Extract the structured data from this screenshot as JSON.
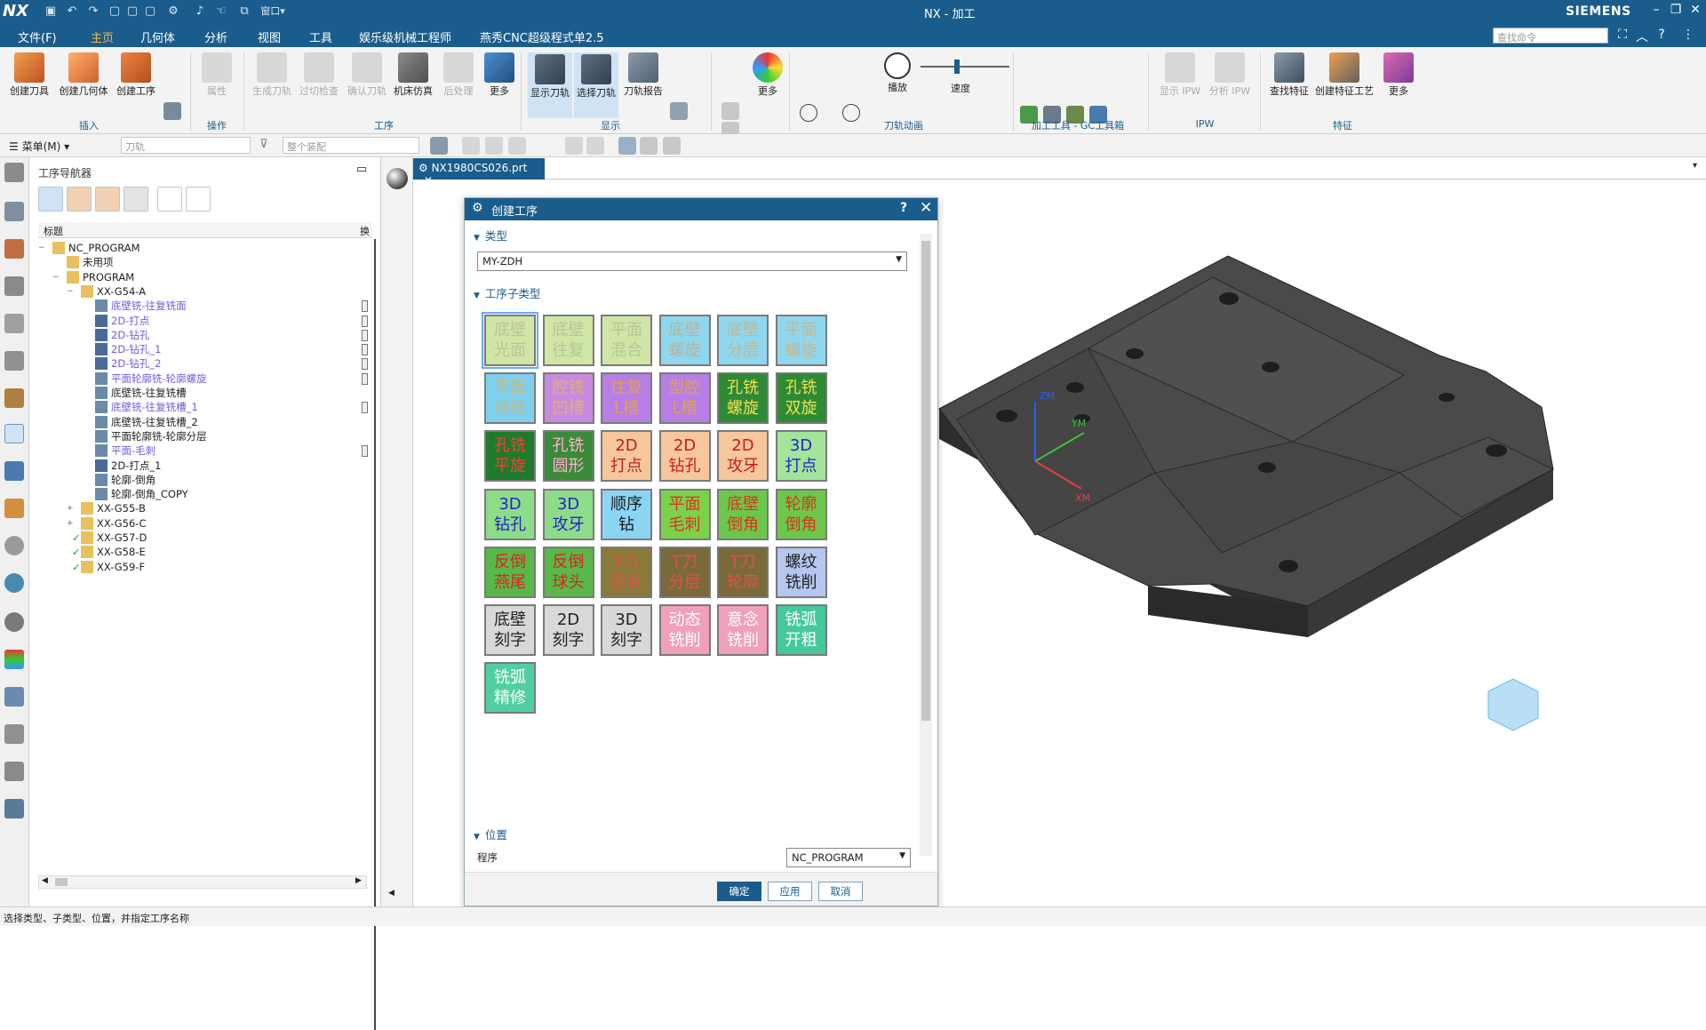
{
  "app": {
    "logo": "NX",
    "title": "NX - 加工",
    "brand": "SIEMENS"
  },
  "menu": {
    "items": [
      "文件(F)",
      "主页",
      "几何体",
      "分析",
      "视图",
      "工具",
      "娱乐级机械工程师",
      "燕秀CNC超级程式单2.5"
    ],
    "search_placeholder": "查找命令"
  },
  "ribbon": {
    "buttons": {
      "create_tool": "创建刀具",
      "create_geometry": "创建几何体",
      "create_operation": "创建工序",
      "properties": "属性",
      "generate_toolpath": "生成刀轨",
      "overcut_check": "过切检查",
      "verify_toolpath": "确认刀轨",
      "machine_sim": "机床仿真",
      "postprocess": "后处理",
      "more1": "更多",
      "show_toolpath": "显示刀轨",
      "select_toolpath": "选择刀轨",
      "toolpath_report": "刀轨报告",
      "more2": "更多",
      "play": "播放",
      "speed": "速度",
      "show_ipw": "显示 IPW",
      "analyze_ipw": "分析 IPW",
      "find_feature": "查找特征",
      "create_feature_process": "创建特征工艺",
      "more3": "更多"
    },
    "groups": {
      "insert": "插入",
      "operation": "操作",
      "process": "工序",
      "display": "显示",
      "toolpath_anim": "刀轨动画",
      "gc_toolkit": "加工工具 - GC工具箱",
      "ipw": "IPW",
      "feature": "特征"
    }
  },
  "selectionbar": {
    "menu": "菜单(M)",
    "filter": "刀轨",
    "scope": "整个装配"
  },
  "navigator": {
    "title": "工序导航器",
    "column_name": "标题",
    "column_change": "换",
    "tree": [
      {
        "label": "NC_PROGRAM",
        "level": 0,
        "color": "normal",
        "icon": "folder-icon",
        "mark": false
      },
      {
        "label": "未用项",
        "level": 1,
        "color": "normal",
        "icon": "folder-icon",
        "mark": false
      },
      {
        "label": "PROGRAM",
        "level": 1,
        "color": "normal",
        "icon": "folder-icon",
        "mark": false
      },
      {
        "label": "XX-G54-A",
        "level": 2,
        "color": "normal",
        "icon": "folder-icon",
        "mark": false
      },
      {
        "label": "底壁铣-往复铣面",
        "level": 3,
        "color": "purple",
        "icon": "op-icon",
        "mark": true
      },
      {
        "label": "2D-打点",
        "level": 3,
        "color": "purple",
        "icon": "drill-icon",
        "mark": true
      },
      {
        "label": "2D-钻孔",
        "level": 3,
        "color": "purple",
        "icon": "drill-icon",
        "mark": true
      },
      {
        "label": "2D-钻孔_1",
        "level": 3,
        "color": "purple",
        "icon": "drill-icon",
        "mark": true
      },
      {
        "label": "2D-钻孔_2",
        "level": 3,
        "color": "purple",
        "icon": "drill-icon",
        "mark": true
      },
      {
        "label": "平面轮廓铣-轮廓螺旋",
        "level": 3,
        "color": "purple",
        "icon": "op-icon",
        "mark": true
      },
      {
        "label": "底壁铣-往复铣槽",
        "level": 3,
        "color": "normal",
        "icon": "op-icon",
        "mark": false
      },
      {
        "label": "底壁铣-往复铣槽_1",
        "level": 3,
        "color": "purple",
        "icon": "op-icon",
        "mark": true
      },
      {
        "label": "底壁铣-往复铣槽_2",
        "level": 3,
        "color": "normal",
        "icon": "op-icon",
        "mark": false
      },
      {
        "label": "平面轮廓铣-轮廓分层",
        "level": 3,
        "color": "normal",
        "icon": "op-icon",
        "mark": false
      },
      {
        "label": "平面-毛刺",
        "level": 3,
        "color": "purple",
        "icon": "op-icon",
        "mark": true
      },
      {
        "label": "2D-打点_1",
        "level": 3,
        "color": "normal",
        "icon": "drill-icon",
        "mark": false
      },
      {
        "label": "轮廓-倒角",
        "level": 3,
        "color": "normal",
        "icon": "op-icon",
        "mark": false
      },
      {
        "label": "轮廓-倒角_COPY",
        "level": 3,
        "color": "normal",
        "icon": "op-icon",
        "mark": false
      },
      {
        "label": "XX-G55-B",
        "level": 2,
        "color": "normal",
        "icon": "folder-icon",
        "mark": false
      },
      {
        "label": "XX-G56-C",
        "level": 2,
        "color": "normal",
        "icon": "folder-icon",
        "mark": false
      },
      {
        "label": "XX-G57-D",
        "level": 2,
        "color": "normal",
        "icon": "check-folder-icon",
        "mark": false
      },
      {
        "label": "XX-G58-E",
        "level": 2,
        "color": "normal",
        "icon": "check-folder-icon",
        "mark": false
      },
      {
        "label": "XX-G59-F",
        "level": 2,
        "color": "normal",
        "icon": "check-folder-icon",
        "mark": false
      }
    ]
  },
  "graphics": {
    "tab_label": "NX1980CS026.prt",
    "axis_labels": [
      "ZM",
      "YM",
      "XM"
    ]
  },
  "dialog": {
    "title": "创建工序",
    "help": "?",
    "section_type": "类型",
    "type_value": "MY-ZDH",
    "section_subtype": "工序子类型",
    "tiles": [
      {
        "l1": "底壁",
        "l2": "光面",
        "bg": "#cfe6a6",
        "fg": "#b8c49a"
      },
      {
        "l1": "底壁",
        "l2": "往复",
        "bg": "#cfe6a6",
        "fg": "#b8c49a"
      },
      {
        "l1": "平面",
        "l2": "混合",
        "bg": "#cfe6a6",
        "fg": "#b8c49a"
      },
      {
        "l1": "底壁",
        "l2": "螺旋",
        "bg": "#8fd6ef",
        "fg": "#b6b59a"
      },
      {
        "l1": "底壁",
        "l2": "分层",
        "bg": "#8fd6ef",
        "fg": "#c2b88e"
      },
      {
        "l1": "平面",
        "l2": "螺旋",
        "bg": "#8fd6ef",
        "fg": "#c2b88e"
      },
      {
        "l1": "平面",
        "l2": "分层",
        "bg": "#7fd0ef",
        "fg": "#c9b87a"
      },
      {
        "l1": "腔铣",
        "l2": "凹槽",
        "bg": "#c88adf",
        "fg": "#e0b070"
      },
      {
        "l1": "往复",
        "l2": "L槽",
        "bg": "#b77ee6",
        "fg": "#e0a050"
      },
      {
        "l1": "型腔",
        "l2": "L槽",
        "bg": "#b77ee6",
        "fg": "#e0a050"
      },
      {
        "l1": "孔铣",
        "l2": "螺旋",
        "bg": "#2e8a35",
        "fg": "#f0e050"
      },
      {
        "l1": "孔铣",
        "l2": "双旋",
        "bg": "#2e8a35",
        "fg": "#f0e050"
      },
      {
        "l1": "孔铣",
        "l2": "平旋",
        "bg": "#1f7a2b",
        "fg": "#ff3b3b"
      },
      {
        "l1": "孔铣",
        "l2": "圆形",
        "bg": "#3a8a3a",
        "fg": "#ffb0d0"
      },
      {
        "l1": "2D",
        "l2": "打点",
        "bg": "#f6c79a",
        "fg": "#c81c1c"
      },
      {
        "l1": "2D",
        "l2": "钻孔",
        "bg": "#f6c79a",
        "fg": "#c81c1c"
      },
      {
        "l1": "2D",
        "l2": "攻牙",
        "bg": "#f6c79a",
        "fg": "#c81c1c"
      },
      {
        "l1": "3D",
        "l2": "打点",
        "bg": "#a4e39a",
        "fg": "#2424c8"
      },
      {
        "l1": "3D",
        "l2": "钻孔",
        "bg": "#8ddc8a",
        "fg": "#2424c8"
      },
      {
        "l1": "3D",
        "l2": "攻牙",
        "bg": "#8ddc8a",
        "fg": "#2424c8"
      },
      {
        "l1": "顺序",
        "l2": "钻",
        "bg": "#8ad4f4",
        "fg": "#1a1a1a"
      },
      {
        "l1": "平面",
        "l2": "毛刺",
        "bg": "#7ad14a",
        "fg": "#e03020"
      },
      {
        "l1": "底壁",
        "l2": "倒角",
        "bg": "#6cc84a",
        "fg": "#e03020"
      },
      {
        "l1": "轮廓",
        "l2": "倒角",
        "bg": "#6cc84a",
        "fg": "#e03020"
      },
      {
        "l1": "反倒",
        "l2": "燕尾",
        "bg": "#58b84a",
        "fg": "#e02020"
      },
      {
        "l1": "反倒",
        "l2": "球头",
        "bg": "#58b84a",
        "fg": "#e02020"
      },
      {
        "l1": "T刀",
        "l2": "混合",
        "bg": "#8a7a3a",
        "fg": "#e05050"
      },
      {
        "l1": "T刀",
        "l2": "分层",
        "bg": "#7a6a3a",
        "fg": "#e05050"
      },
      {
        "l1": "T刀",
        "l2": "轮廓",
        "bg": "#7a6a3a",
        "fg": "#e05050"
      },
      {
        "l1": "螺纹",
        "l2": "铣削",
        "bg": "#b5c6f0",
        "fg": "#222222"
      },
      {
        "l1": "底壁",
        "l2": "刻字",
        "bg": "#d8d8d8",
        "fg": "#222222"
      },
      {
        "l1": "2D",
        "l2": "刻字",
        "bg": "#d8d8d8",
        "fg": "#222222"
      },
      {
        "l1": "3D",
        "l2": "刻字",
        "bg": "#d8d8d8",
        "fg": "#222222"
      },
      {
        "l1": "动态",
        "l2": "铣削",
        "bg": "#f0a0b8",
        "fg": "#ffffff"
      },
      {
        "l1": "意念",
        "l2": "铣削",
        "bg": "#f0a0b8",
        "fg": "#ffffff"
      },
      {
        "l1": "铣弧",
        "l2": "开粗",
        "bg": "#44c99a",
        "fg": "#ffffff"
      },
      {
        "l1": "铣弧",
        "l2": "精修",
        "bg": "#50d0a0",
        "fg": "#ffffff"
      }
    ],
    "section_position": "位置",
    "program_label": "程序",
    "program_value": "NC_PROGRAM",
    "buttons": {
      "ok": "确定",
      "apply": "应用",
      "cancel": "取消"
    }
  },
  "statusbar": {
    "text": "选择类型、子类型、位置，并指定工序名称"
  }
}
